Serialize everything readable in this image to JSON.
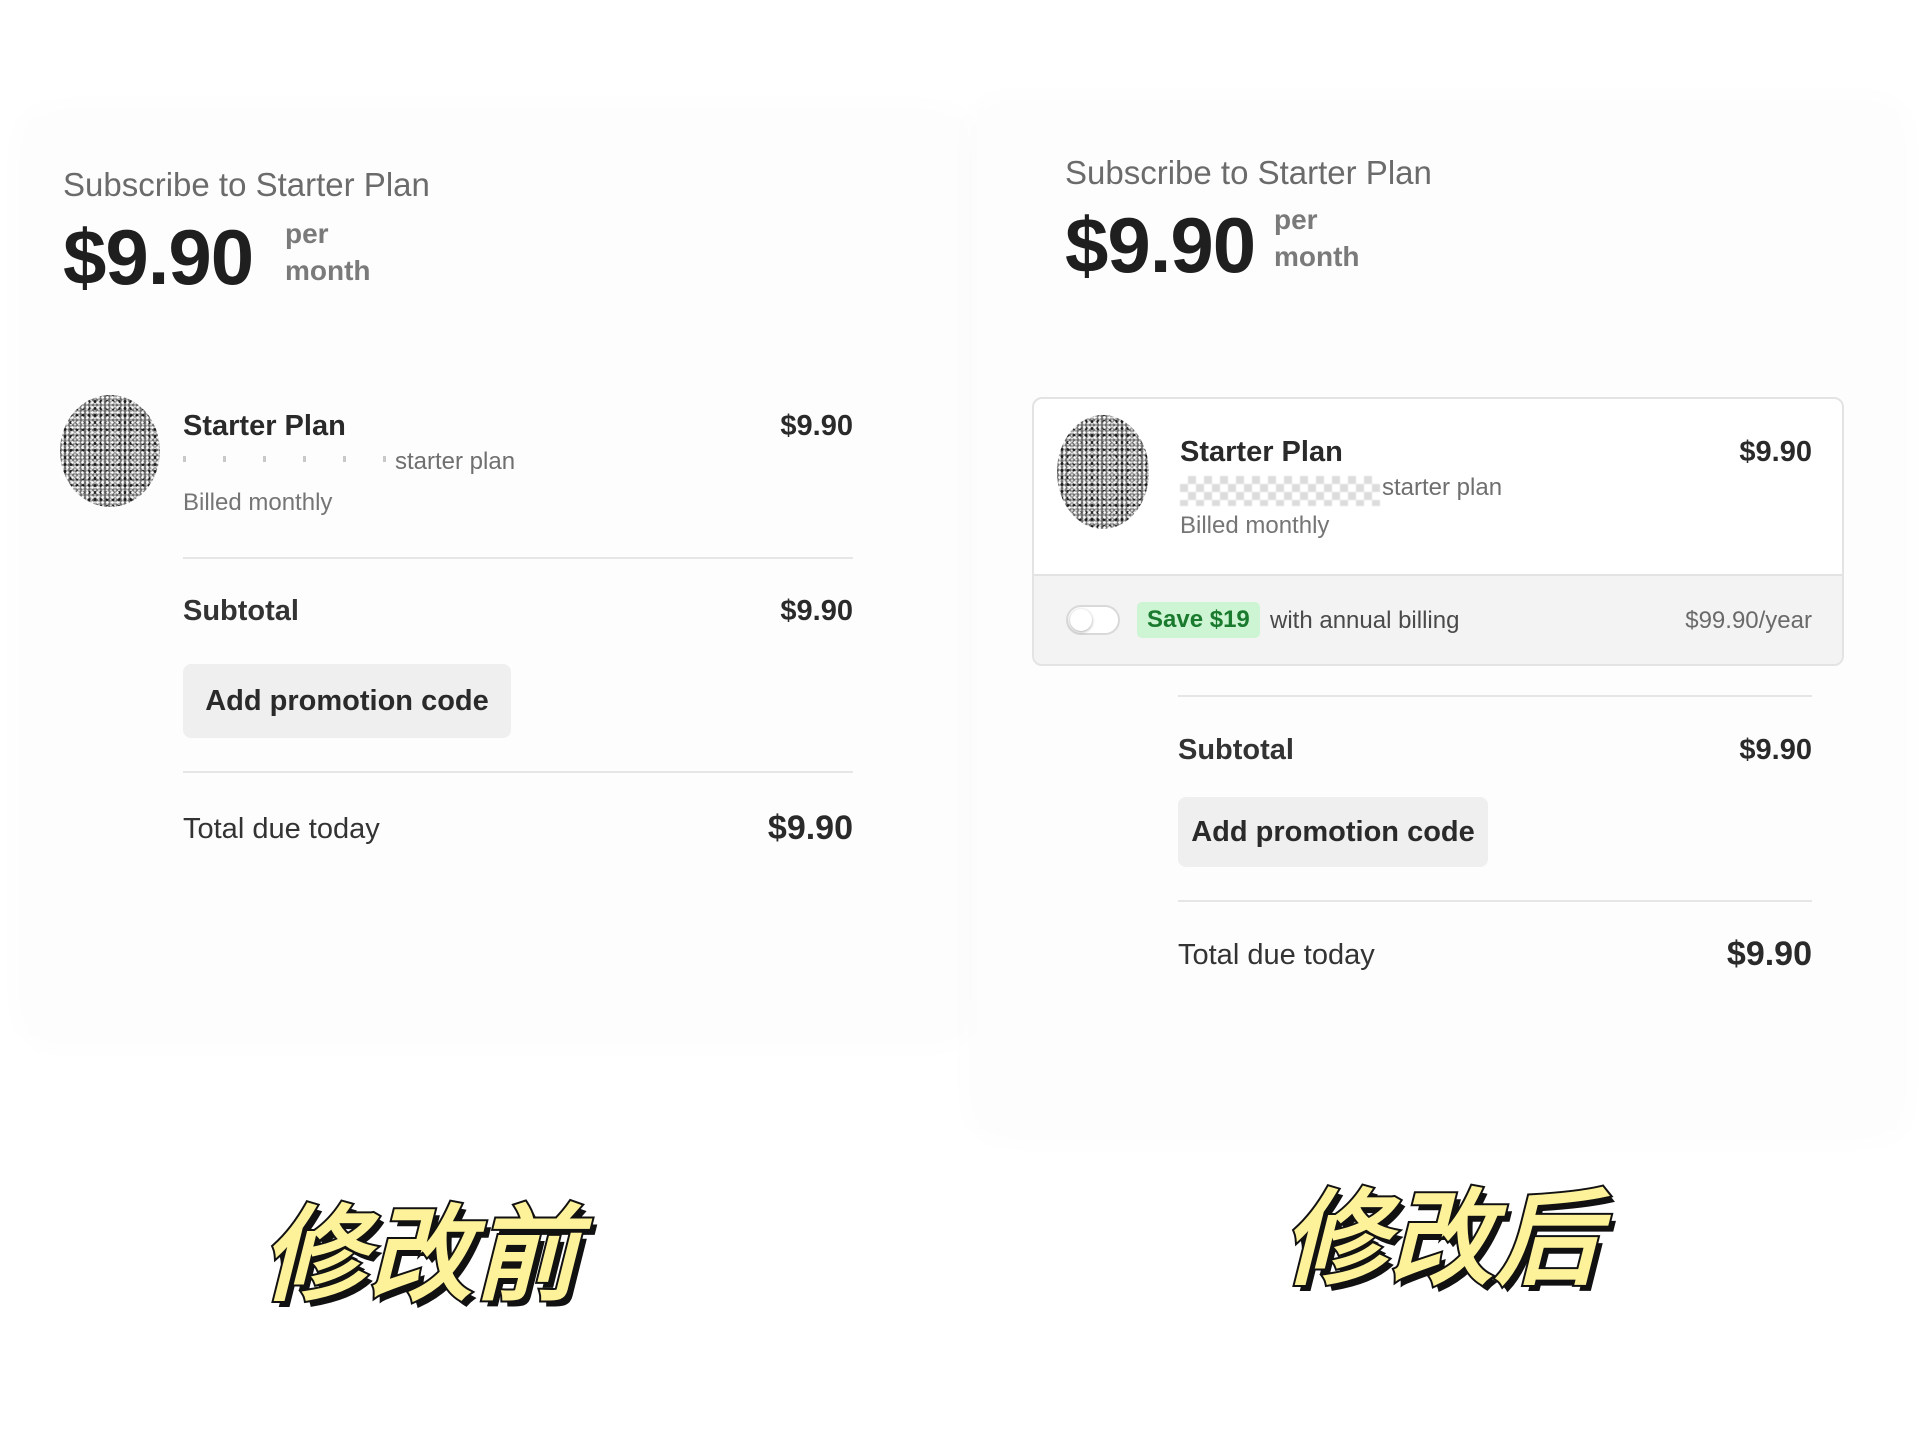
{
  "before": {
    "subscribe_title": "Subscribe to Starter Plan",
    "price": "$9.90",
    "per": "per",
    "period": "month",
    "plan_icon": "plan-thumbnail-image",
    "plan_name": "Starter Plan",
    "plan_desc": "starter plan",
    "plan_billing": "Billed monthly",
    "plan_amount": "$9.90",
    "subtotal_label": "Subtotal",
    "subtotal_amount": "$9.90",
    "promo_label": "Add promotion code",
    "total_label": "Total due today",
    "total_amount": "$9.90"
  },
  "after": {
    "subscribe_title": "Subscribe to Starter Plan",
    "price": "$9.90",
    "per": "per",
    "period": "month",
    "plan_icon": "plan-thumbnail-image",
    "plan_name": "Starter Plan",
    "plan_desc": "starter plan",
    "plan_billing": "Billed monthly",
    "plan_amount": "$9.90",
    "annual_toggle_on": false,
    "save_badge": "Save $19",
    "annual_text": "with annual billing",
    "annual_price": "$99.90/year",
    "subtotal_label": "Subtotal",
    "subtotal_amount": "$9.90",
    "promo_label": "Add promotion code",
    "total_label": "Total due today",
    "total_amount": "$9.90"
  },
  "captions": {
    "before": "修改前",
    "after": "修改后"
  },
  "colors": {
    "badge_bg": "#cdf5d3",
    "badge_text": "#1a7a2e",
    "caption_fill": "#fdf29a",
    "caption_stroke": "#111111"
  }
}
